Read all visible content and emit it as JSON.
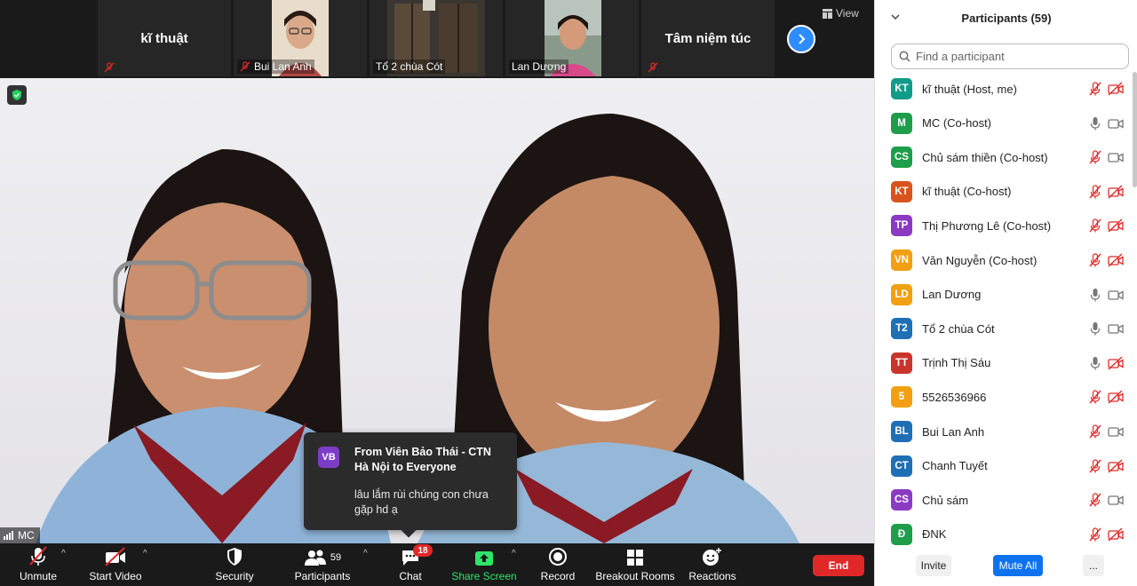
{
  "strip": {
    "tiles": [
      {
        "name": "kĩ thuật",
        "label": "",
        "muted": true
      },
      {
        "name": "",
        "label": "Bui Lan Anh",
        "muted": true
      },
      {
        "name": "",
        "label": "Tổ 2 chùa Cót",
        "muted": false
      },
      {
        "name": "",
        "label": "Lan Dương",
        "muted": false
      },
      {
        "name": "Tâm niệm túc",
        "label": "",
        "muted": true
      }
    ],
    "view_label": "View"
  },
  "stage": {
    "speaker_name": "MC"
  },
  "chat_popup": {
    "avatar": "VB",
    "from": "From Viên Bảo Thái - CTN Hà Nội to Everyone",
    "message": "lâu lắm rùi chúng con chưa gặp hd ạ"
  },
  "toolbar": {
    "unmute": "Unmute",
    "start_video": "Start Video",
    "security": "Security",
    "participants": "Participants",
    "participants_count": "59",
    "chat": "Chat",
    "chat_badge": "18",
    "share_screen": "Share Screen",
    "record": "Record",
    "breakout_rooms": "Breakout Rooms",
    "reactions": "Reactions",
    "end": "End"
  },
  "panel": {
    "title": "Participants (59)",
    "search_placeholder": "Find a participant",
    "participants": [
      {
        "initials": "KT",
        "color": "#0f9d8a",
        "name": "kĩ thuật (Host, me)",
        "mic": "muted",
        "cam": "off"
      },
      {
        "initials": "M",
        "color": "#1e9e4a",
        "name": "MC (Co-host)",
        "mic": "on",
        "cam": "on"
      },
      {
        "initials": "CS",
        "color": "#1e9e4a",
        "name": "Chủ sám thiền (Co-host)",
        "mic": "muted",
        "cam": "on"
      },
      {
        "initials": "KT",
        "color": "#d8541e",
        "name": "kĩ thuật (Co-host)",
        "mic": "muted",
        "cam": "off"
      },
      {
        "initials": "TP",
        "color": "#8a3bc2",
        "name": "Thị Phương Lê (Co-host)",
        "mic": "muted",
        "cam": "off"
      },
      {
        "initials": "VN",
        "color": "#f0a012",
        "name": "Văn Nguyễn (Co-host)",
        "mic": "muted",
        "cam": "off"
      },
      {
        "initials": "LD",
        "color": "#f0a012",
        "name": "Lan Dương",
        "mic": "on",
        "cam": "on"
      },
      {
        "initials": "T2",
        "color": "#1f6fb5",
        "name": "Tổ 2 chùa Cót",
        "mic": "on",
        "cam": "on"
      },
      {
        "initials": "TT",
        "color": "#c8352b",
        "name": "Trịnh Thị Sáu",
        "mic": "on",
        "cam": "off"
      },
      {
        "initials": "5",
        "color": "#f0a012",
        "name": "5526536966",
        "mic": "muted",
        "cam": "off"
      },
      {
        "initials": "BL",
        "color": "#1f6fb5",
        "name": "Bui Lan Anh",
        "mic": "muted",
        "cam": "on"
      },
      {
        "initials": "CT",
        "color": "#1f6fb5",
        "name": "Chanh Tuyết",
        "mic": "muted",
        "cam": "off"
      },
      {
        "initials": "CS",
        "color": "#8a3bc2",
        "name": "Chủ sám",
        "mic": "muted",
        "cam": "on"
      },
      {
        "initials": "Đ",
        "color": "#1e9e4a",
        "name": "ĐNK",
        "mic": "muted",
        "cam": "off"
      }
    ],
    "invite": "Invite",
    "mute_all": "Mute All",
    "more": "..."
  }
}
